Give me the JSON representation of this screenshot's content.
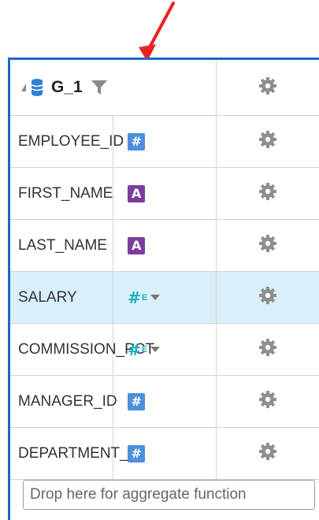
{
  "group": {
    "name": "G_1"
  },
  "fields": [
    {
      "name": "EMPLOYEE_ID",
      "type_icon": "number-type-icon",
      "selected": false
    },
    {
      "name": "FIRST_NAME",
      "type_icon": "string-type-icon",
      "selected": false
    },
    {
      "name": "LAST_NAME",
      "type_icon": "string-type-icon",
      "selected": false
    },
    {
      "name": "SALARY",
      "type_icon": "number-expression-dropdown-icon",
      "selected": true
    },
    {
      "name": "COMMISSION_PCT",
      "type_icon": "number-expression-dropdown-icon",
      "selected": false
    },
    {
      "name": "MANAGER_ID",
      "type_icon": "number-type-icon",
      "selected": false
    },
    {
      "name": "DEPARTMENT_ID",
      "type_icon": "number-type-icon",
      "selected": false
    }
  ],
  "icons": {
    "number_badge": "#",
    "string_badge": "A",
    "expr_hash": "#",
    "expr_e": "E"
  },
  "aggregate_drop": {
    "placeholder": "Drop here for aggregate function"
  },
  "colors": {
    "accent_border": "#1f66c7",
    "arrow": "#e8231d",
    "selected_row": "#d9effa",
    "number_badge": "#4a90dc",
    "string_badge": "#7c3e9e",
    "expression": "#1ab0c8"
  }
}
